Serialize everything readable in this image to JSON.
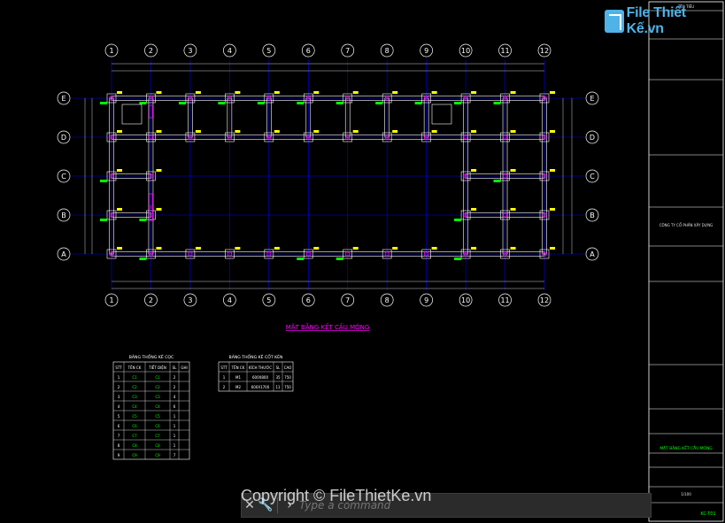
{
  "drawing": {
    "grid_cols": [
      "1",
      "2",
      "3",
      "4",
      "5",
      "6",
      "7",
      "8",
      "9",
      "10",
      "11",
      "12"
    ],
    "grid_rows": [
      "E",
      "D",
      "C",
      "B",
      "A"
    ],
    "plan_title": "MẶT BẰNG KẾT CẤU MÓNG",
    "colors": {
      "grid": "#0000ff",
      "beam": "#ffffff",
      "column": "#ff00ff",
      "rebar": "#00ff00",
      "text": "#ffff00",
      "title": "#ff00ff"
    }
  },
  "table1": {
    "title": "BẢNG THỐNG KÊ CỌC",
    "headers": [
      "STT",
      "TÊN CK",
      "TIẾT DIỆN",
      "SL",
      "GHI"
    ],
    "rows": [
      [
        "1",
        "C1",
        "C1",
        "2"
      ],
      [
        "2",
        "C2",
        "C2",
        "2"
      ],
      [
        "3",
        "C3",
        "C3",
        "4"
      ],
      [
        "4",
        "C4",
        "C4",
        "6"
      ],
      [
        "5",
        "C5",
        "C5",
        "1"
      ],
      [
        "6",
        "C6",
        "C6",
        "1"
      ],
      [
        "7",
        "C7",
        "C7",
        "1"
      ],
      [
        "8",
        "C8",
        "C8",
        "1"
      ],
      [
        "9",
        "C9",
        "C9",
        "7"
      ]
    ]
  },
  "table2": {
    "title": "BẢNG THỐNG KÊ CỐT KÉN",
    "headers": [
      "STT",
      "TÊN CK",
      "KÍCH THƯỚC",
      "SL",
      "CAO"
    ],
    "rows": [
      [
        "1",
        "M1",
        "600X800",
        "35",
        "750"
      ],
      [
        "2",
        "M2",
        "600X1700",
        "11",
        "750"
      ]
    ]
  },
  "title_block": {
    "header_small": "TÊN TIÊU",
    "owner": "CÔNG TY CỔ PHẦN XÂY DỰNG",
    "drawing_name": "MẶT BẰNG KẾT CẤU MÓNG",
    "sheet_label": "KC-T01",
    "scale": "1/100"
  },
  "logo": {
    "text": "File Thiết Kế.vn"
  },
  "watermark": {
    "text": "Copyright © FileThietKe.vn"
  },
  "command_line": {
    "placeholder": "Type a command",
    "close_icon": "close-icon",
    "wrench_icon": "wrench-icon"
  }
}
